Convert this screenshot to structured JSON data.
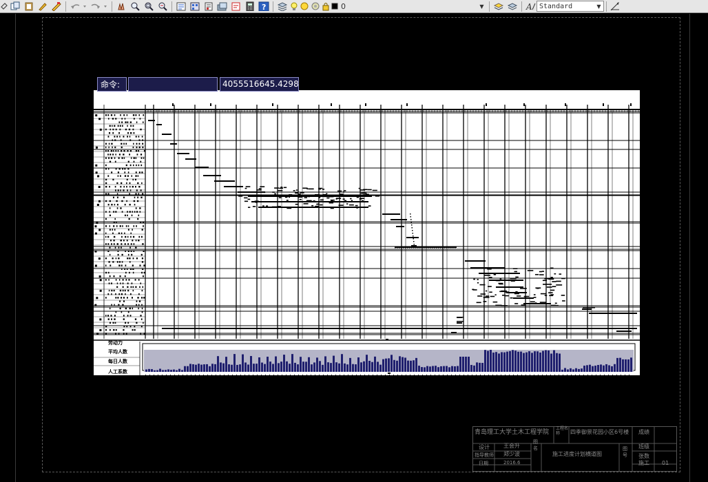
{
  "toolbar": {
    "icons": [
      "match-properties-icon",
      "copy-icon",
      "clipboard-icon",
      "brush-icon",
      "paste-icon",
      "undo-icon",
      "redo-icon",
      "pan-icon",
      "zoom-realtime-icon",
      "zoom-window-icon",
      "zoom-previous-icon",
      "properties-icon",
      "design-center-icon",
      "tool-palettes-icon",
      "sheet-set-icon",
      "markup-icon",
      "calculator-icon",
      "help-icon",
      "layer-manager-icon",
      "lightbulb-icon",
      "sun-icon",
      "freeze-icon",
      "lock-icon",
      "color-swatch-icon",
      "layer-states-icon",
      "layer-previous-icon",
      "text-style-icon",
      "dimension-style-icon"
    ],
    "layer_name": "0",
    "text_style": "Standard",
    "colors": {
      "background": "#e6e6e6",
      "sun": "#ffd83a",
      "bulb": "#fff06a"
    }
  },
  "command": {
    "label": "命令:",
    "value": "",
    "coordinate_readout": "4055516645.4298"
  },
  "drawing": {
    "resource_labels": [
      "劳动力",
      "平均人数",
      "每日人数",
      "人工系数"
    ],
    "colors": {
      "histogram": "#1f1f6e",
      "histogram_fill": "#b5b5c8",
      "model_space": "#000000"
    }
  },
  "title_block": {
    "school": "青岛理工大学土木工程学院",
    "project_label": "工程名称",
    "project": "四季御景花园小区6号楼",
    "score_label": "成绩",
    "design_label": "设计",
    "designer": "王会升",
    "advisor_label": "指导教师",
    "advisor": "郑少波",
    "date_label": "日期",
    "date": "2016.6",
    "title_label": "图名",
    "drawing_title": "施工进度计划横道图",
    "number_label": "图号",
    "section_label": "班级",
    "sheet_label": "张数",
    "construction_label": "施工",
    "sheet_number": "01"
  },
  "screen_colors": {
    "canvas": "#000000",
    "frame": "#3a3a3a",
    "command_bg": "#1c1c4a",
    "title_block_text": "#8a8a8a"
  }
}
